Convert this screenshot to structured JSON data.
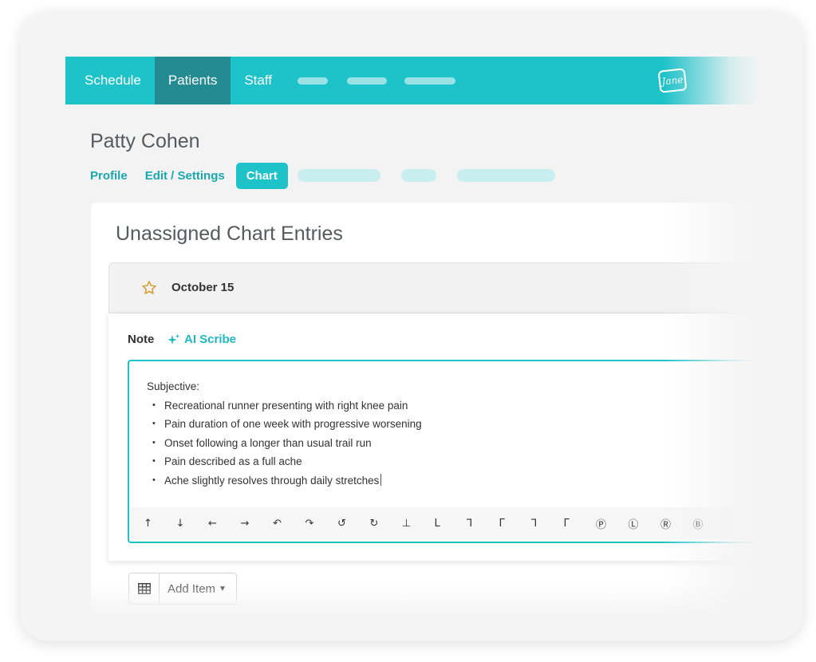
{
  "nav": {
    "items": [
      "Schedule",
      "Patients",
      "Staff"
    ],
    "active": "Patients",
    "logo_text": "Jane"
  },
  "patient": {
    "name": "Patty Cohen"
  },
  "subtabs": {
    "items": [
      "Profile",
      "Edit / Settings",
      "Chart"
    ],
    "active": "Chart"
  },
  "panel": {
    "title": "Unassigned Chart Entries"
  },
  "entry": {
    "date": "October 15",
    "note_label": "Note",
    "ai_scribe_label": "AI Scribe",
    "heading": "Subjective:",
    "bullets": [
      "Recreational runner presenting with right knee pain",
      "Pain duration of one week with progressive worsening",
      "Onset following a longer than usual trail run",
      "Pain described as a full ache",
      "Ache slightly resolves through daily stretches"
    ],
    "toolbar_symbols": [
      "↑",
      "↓",
      "←",
      "→",
      "↶",
      "↷",
      "↺",
      "↻",
      "⊥",
      "L",
      "⅂",
      "Γ",
      "⅂",
      "Γ",
      "Ⓟ",
      "Ⓛ",
      "Ⓡ",
      "Ⓑ"
    ]
  },
  "actions": {
    "add_item_label": "Add Item"
  },
  "colors": {
    "brand": "#1ec2c9",
    "brand_dark": "#248b92",
    "star": "#d89a2a"
  }
}
